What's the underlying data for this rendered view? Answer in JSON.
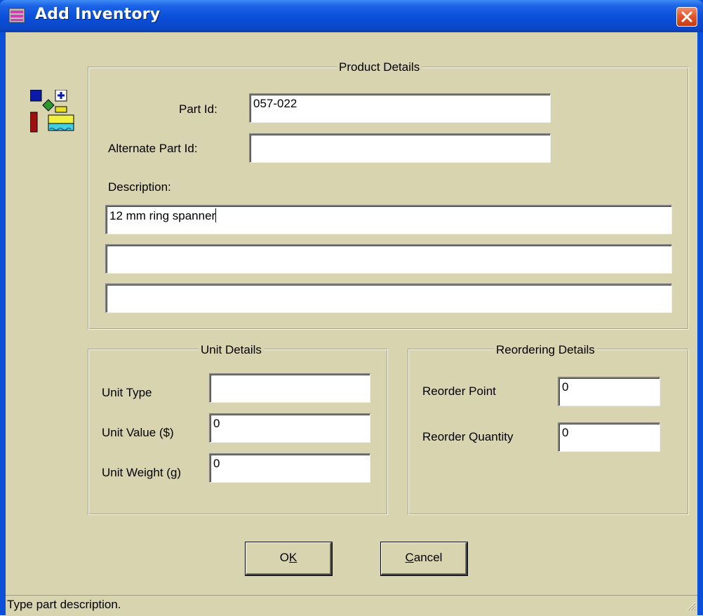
{
  "window": {
    "title": "Add Inventory",
    "close_icon": "close-icon",
    "app_icon": "inventory-app-icon"
  },
  "product_details": {
    "legend": "Product Details",
    "part_id_label": "Part Id:",
    "part_id_value": "057-022",
    "alt_part_id_label": "Alternate Part Id:",
    "alt_part_id_value": "",
    "description_label": "Description:",
    "description_lines": [
      "12 mm ring spanner",
      "",
      ""
    ]
  },
  "unit_details": {
    "legend": "Unit Details",
    "unit_type_label": "Unit Type",
    "unit_type_value": "",
    "unit_value_label": "Unit Value ($)",
    "unit_value_value": "0",
    "unit_weight_label": "Unit Weight (g)",
    "unit_weight_value": "0"
  },
  "reordering_details": {
    "legend": "Reordering Details",
    "reorder_point_label": "Reorder Point",
    "reorder_point_value": "0",
    "reorder_quantity_label": "Reorder Quantity",
    "reorder_quantity_value": "0"
  },
  "buttons": {
    "ok_prefix": "O",
    "ok_underlined": "K",
    "cancel_underlined": "C",
    "cancel_suffix": "ancel"
  },
  "status": {
    "text": "Type part description."
  },
  "colors": {
    "title_bar": "#0a4fd8",
    "dialog_face": "#d8d4b0",
    "close_button": "#e2582e"
  }
}
